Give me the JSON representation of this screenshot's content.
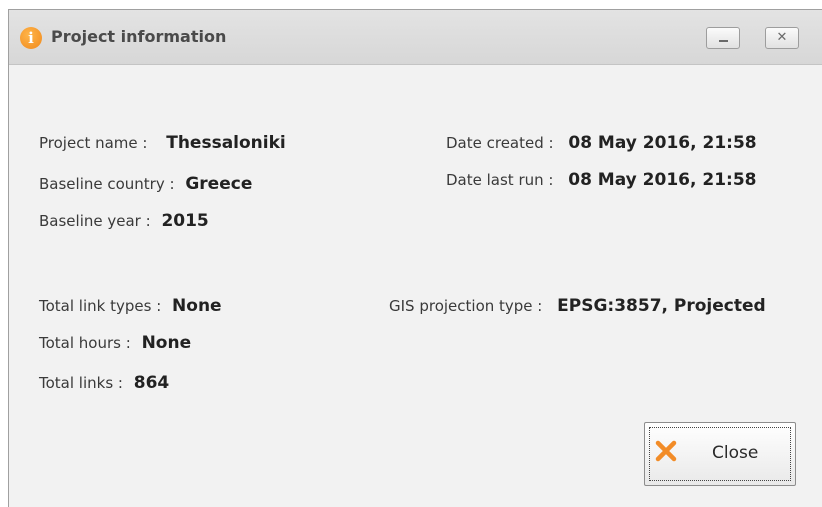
{
  "window": {
    "title": "Project information",
    "icon": "info-icon",
    "minimize_icon": "minimize-icon",
    "close_icon": "close-icon"
  },
  "fields": {
    "project_name": {
      "label": "Project name :",
      "value": "Thessaloniki"
    },
    "baseline_country": {
      "label": "Baseline country :",
      "value": "Greece"
    },
    "baseline_year": {
      "label": "Baseline year :",
      "value": "2015"
    },
    "date_created": {
      "label": "Date created :",
      "value": "08 May 2016, 21:58"
    },
    "date_last_run": {
      "label": "Date last run :",
      "value": "08 May 2016, 21:58"
    },
    "total_link_types": {
      "label": "Total link types :",
      "value": "None"
    },
    "total_hours": {
      "label": "Total hours :",
      "value": "None"
    },
    "total_links": {
      "label": "Total links :",
      "value": "864"
    },
    "gis_projection": {
      "label": "GIS projection type :",
      "value": "EPSG:3857, Projected"
    }
  },
  "buttons": {
    "close": {
      "label": "Close",
      "icon": "x-icon",
      "icon_color": "#f28c28"
    }
  }
}
